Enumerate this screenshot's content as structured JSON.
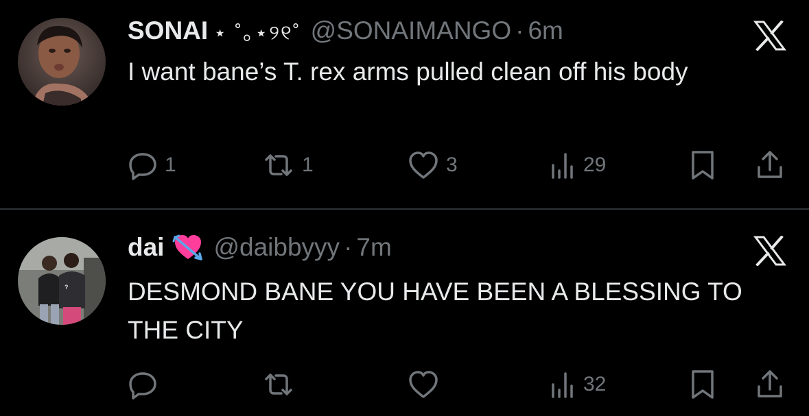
{
  "tweets": [
    {
      "display_name": "SONAI",
      "name_decoration": "⋆ ˚｡⋆୨୧˚",
      "handle": "@SONAIMANGO",
      "separator": "·",
      "time": "6m",
      "text": "I want bane’s T. rex arms pulled clean off his body",
      "reply_count": "1",
      "retweet_count": "1",
      "like_count": "3",
      "view_count": "29",
      "icons": [
        "x-logo-icon",
        "reply-icon",
        "retweet-icon",
        "heart-icon",
        "views-icon",
        "bookmark-icon",
        "share-icon"
      ]
    },
    {
      "display_name": "dai",
      "name_emoji": "heart-with-arrow",
      "handle": "@daibbyyy",
      "separator": "·",
      "time": "7m",
      "text": "DESMOND BANE YOU HAVE BEEN A BLESSING TO THE CITY",
      "reply_count": "",
      "retweet_count": "",
      "like_count": "",
      "view_count": "32",
      "icons": [
        "x-logo-icon",
        "reply-icon",
        "retweet-icon",
        "heart-icon",
        "views-icon",
        "bookmark-icon",
        "share-icon"
      ]
    }
  ],
  "colors": {
    "background": "#000000",
    "primary_text": "#e7e9ea",
    "secondary_text": "#71767b",
    "divider": "#2f3336",
    "emoji_heart": "#ff3d9a",
    "emoji_arrow": "#5aa7e8"
  }
}
